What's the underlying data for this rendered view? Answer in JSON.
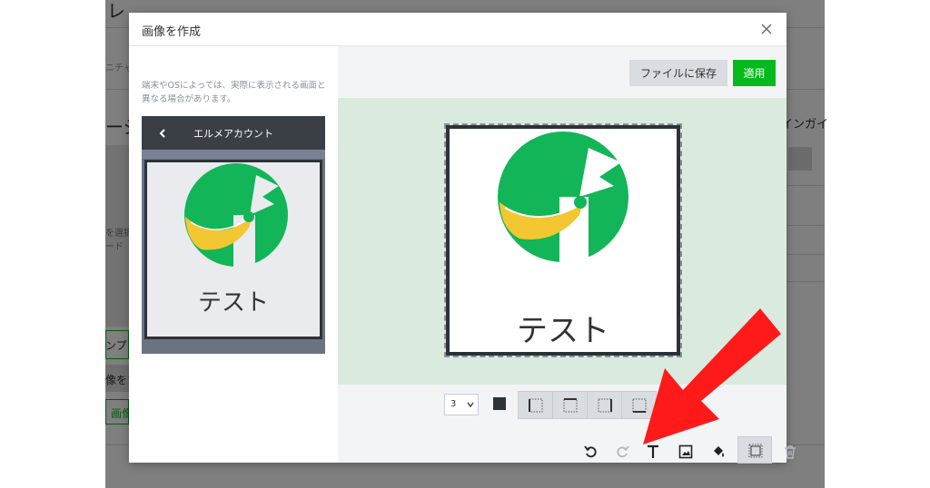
{
  "background": {
    "header_char": "レ",
    "snippet_1": "ニチャ",
    "snippet_2": "ージ",
    "snippet_3": "インガイ",
    "snippet_4": "を選択",
    "snippet_5": "ード",
    "snippet_6": "ンプレ",
    "snippet_7": "像をア",
    "snippet_8": "画像"
  },
  "modal": {
    "title": "画像を作成",
    "note": "端末やOSによっては、実際に表示される画面と異なる場合があります。",
    "phone_header": "エルメアカウント",
    "image_text": "テスト",
    "save_label": "ファイルに保存",
    "apply_label": "適用",
    "border_width": "3"
  },
  "colors": {
    "accent_green": "#06b91c",
    "logo_green": "#12b558",
    "logo_yellow": "#f2c731",
    "arrow_red": "#ff1a1a",
    "dark": "#2d3238"
  },
  "icons": {
    "close": "close-icon",
    "back": "chevron-left-icon",
    "undo": "undo-icon",
    "redo": "redo-icon",
    "text": "text-icon",
    "image": "image-icon",
    "fill": "paint-bucket-icon",
    "frame": "frame-icon",
    "trash": "trash-icon"
  }
}
